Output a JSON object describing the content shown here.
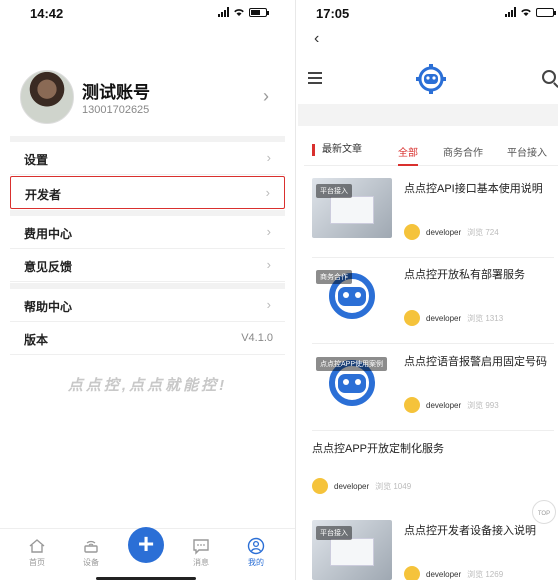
{
  "left": {
    "status_time": "14:42",
    "profile": {
      "name": "测试账号",
      "phone": "13001702625"
    },
    "menu": [
      {
        "label": "设置"
      },
      {
        "label": "开发者"
      },
      {
        "label": "费用中心"
      },
      {
        "label": "意见反馈"
      },
      {
        "label": "帮助中心"
      },
      {
        "label": "版本",
        "value": "V4.1.0"
      }
    ],
    "slogan": "点点控,点点就能控!",
    "tabs": [
      {
        "label": "首页",
        "icon": "home-icon"
      },
      {
        "label": "设备",
        "icon": "router-icon"
      },
      {
        "label": "",
        "icon": "plus-icon"
      },
      {
        "label": "消息",
        "icon": "message-icon"
      },
      {
        "label": "我的",
        "icon": "user-icon"
      }
    ]
  },
  "right": {
    "status_time": "17:05",
    "categories": {
      "latest": "最新文章",
      "items": [
        "全部",
        "商务合作",
        "平台接入"
      ],
      "active": "全部"
    },
    "articles": [
      {
        "tag": "平台接入",
        "title": "点点控API接口基本使用说明",
        "author": "developer",
        "views": "浏览 724"
      },
      {
        "tag": "商务合作",
        "title": "点点控开放私有部署服务",
        "author": "developer",
        "views": "浏览 1313"
      },
      {
        "tag": "点点控APP使用案例",
        "title": "点点控语音报警启用固定号码",
        "author": "developer",
        "views": "浏览 993"
      },
      {
        "title": "点点控APP开放定制化服务",
        "author": "developer",
        "views": "浏览 1049"
      },
      {
        "tag": "平台接入",
        "title": "点点控开发者设备接入说明",
        "author": "developer",
        "views": "浏览 1269"
      }
    ],
    "top_button": "TOP"
  },
  "colors": {
    "accent_red": "#d9302e",
    "accent_blue": "#2b6fd6"
  }
}
